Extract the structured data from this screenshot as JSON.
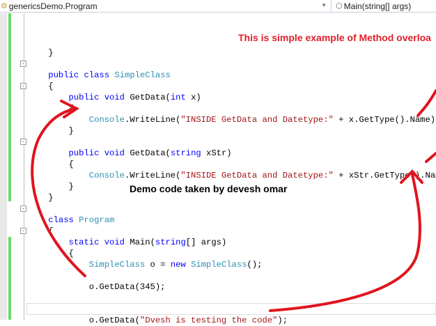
{
  "nav": {
    "class_selector": "genericsDemo.Program",
    "member_selector": "Main(string[] args)"
  },
  "code": [
    "",
    "",
    "",
    "    }",
    "",
    "    public class SimpleClass",
    "    {",
    "        public void GetData(int x)",
    "        {",
    "            Console.WriteLine(\"INSIDE GetData and Datetype:\" + x.GetType().Name);",
    "        }",
    "",
    "        public void GetData(string xStr)",
    "        {",
    "            Console.WriteLine(\"INSIDE GetData and Datetype:\" + xStr.GetType().Name);",
    "        }",
    "    }",
    "",
    "    class Program",
    "    {",
    "        static void Main(string[] args)",
    "        {",
    "            SimpleClass o = new SimpleClass();",
    "",
    "            o.GetData(345);",
    "",
    "",
    "            o.GetData(\"Dvesh is testing the code\");"
  ],
  "annotations": {
    "title": "This is simple example of Method overloa",
    "credit": "Demo code taken by devesh omar"
  },
  "colors": {
    "keyword": "#0000ff",
    "type": "#2b91af",
    "string": "#a31515",
    "annotation": "#e0202a"
  }
}
